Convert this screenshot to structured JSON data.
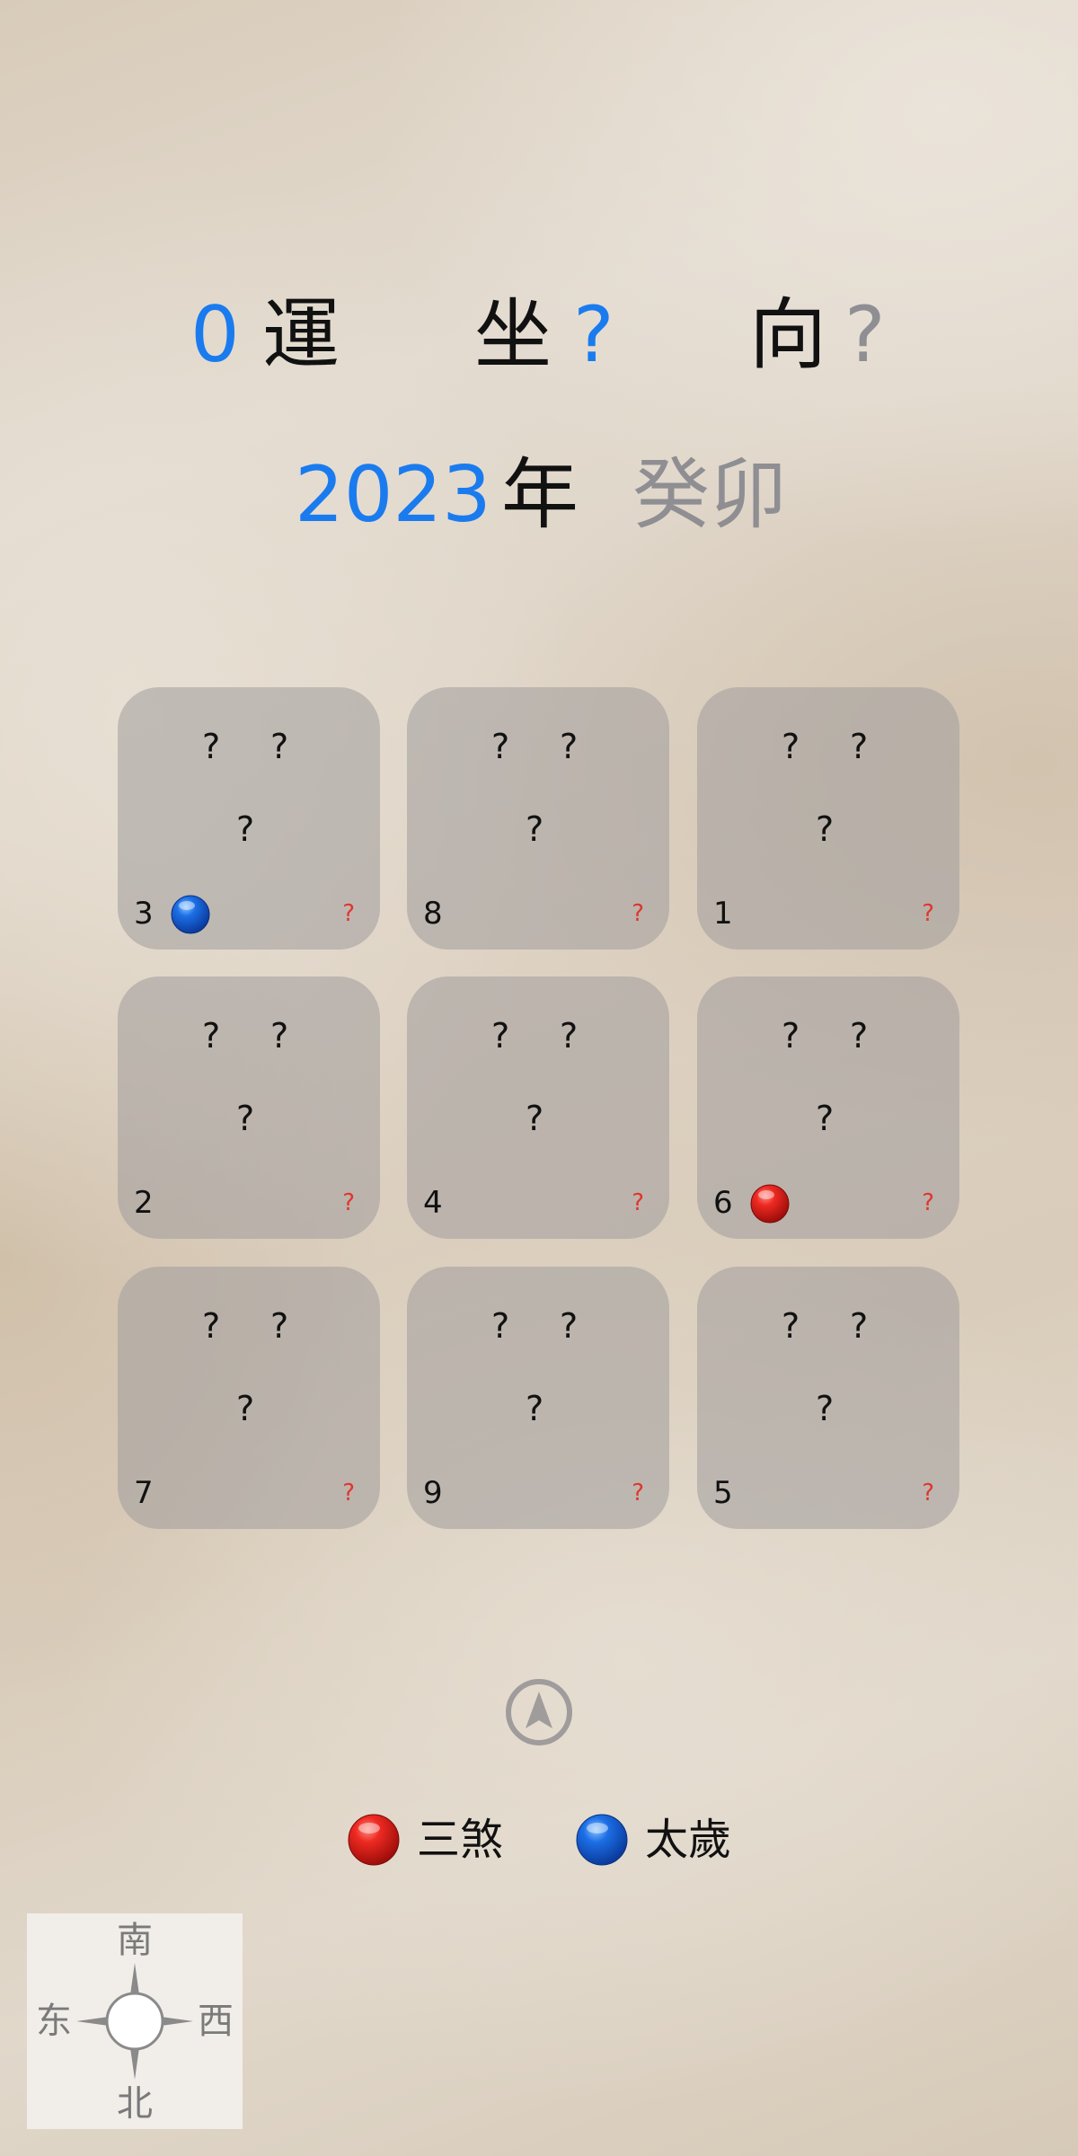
{
  "header": {
    "period_number": "0",
    "period_label": "運",
    "sitting_label": "坐",
    "sitting_value": "?",
    "facing_label": "向",
    "facing_value": "?"
  },
  "year": {
    "number": "2023",
    "label": "年",
    "ganzhi": "癸卯"
  },
  "grid": {
    "cells": [
      {
        "q_left": "?",
        "q_right": "?",
        "q_center": "?",
        "star": "3",
        "corner": "?",
        "marker": "tai-sui"
      },
      {
        "q_left": "?",
        "q_right": "?",
        "q_center": "?",
        "star": "8",
        "corner": "?",
        "marker": ""
      },
      {
        "q_left": "?",
        "q_right": "?",
        "q_center": "?",
        "star": "1",
        "corner": "?",
        "marker": ""
      },
      {
        "q_left": "?",
        "q_right": "?",
        "q_center": "?",
        "star": "2",
        "corner": "?",
        "marker": ""
      },
      {
        "q_left": "?",
        "q_right": "?",
        "q_center": "?",
        "star": "4",
        "corner": "?",
        "marker": ""
      },
      {
        "q_left": "?",
        "q_right": "?",
        "q_center": "?",
        "star": "6",
        "corner": "?",
        "marker": "san-sha"
      },
      {
        "q_left": "?",
        "q_right": "?",
        "q_center": "?",
        "star": "7",
        "corner": "?",
        "marker": ""
      },
      {
        "q_left": "?",
        "q_right": "?",
        "q_center": "?",
        "star": "9",
        "corner": "?",
        "marker": ""
      },
      {
        "q_left": "?",
        "q_right": "?",
        "q_center": "?",
        "star": "5",
        "corner": "?",
        "marker": ""
      }
    ]
  },
  "legend": {
    "san_sha": "三煞",
    "tai_sui": "太歲"
  },
  "compass": {
    "south": "南",
    "north": "北",
    "east": "东",
    "west": "西"
  },
  "icons": {
    "locate": "location-arrow-icon",
    "red_marker": "red-ball-icon",
    "blue_marker": "blue-ball-icon",
    "compass": "compass-rose-icon"
  },
  "colors": {
    "accent_blue": "#1a7bef",
    "muted_gray": "#8e8e93",
    "warning_red": "#e0362c",
    "cell_bg": "#a09c9c"
  }
}
